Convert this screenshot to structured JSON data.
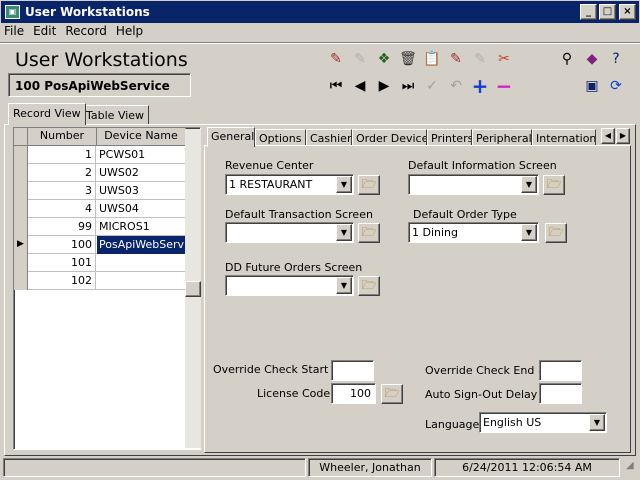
{
  "window": {
    "title": "User Workstations",
    "btn_min": "_",
    "btn_max": "□",
    "btn_close": "×"
  },
  "menu": {
    "file": "File",
    "edit": "Edit",
    "record": "Record",
    "help": "Help"
  },
  "header": {
    "title": "User Workstations",
    "record": "100 PosApiWebService"
  },
  "view_tabs": {
    "record": "Record View",
    "table": "Table View"
  },
  "grid": {
    "col_number": "Number",
    "col_name": "Device Name",
    "rows": [
      {
        "number": "1",
        "name": "PCWS01"
      },
      {
        "number": "2",
        "name": "UWS02"
      },
      {
        "number": "3",
        "name": "UWS03"
      },
      {
        "number": "4",
        "name": "UWS04"
      },
      {
        "number": "99",
        "name": "MICROS1"
      },
      {
        "number": "100",
        "name": "PosApiWebService"
      },
      {
        "number": "101",
        "name": ""
      },
      {
        "number": "102",
        "name": ""
      }
    ],
    "selected_index": 5
  },
  "tabs": [
    "General",
    "Options",
    "Cashier",
    "Order Devices",
    "Printers",
    "Peripherals",
    "Internation"
  ],
  "form": {
    "revenue_center_label": "Revenue Center",
    "revenue_center_value": "1  RESTAURANT",
    "default_info_screen_label": "Default Information Screen",
    "default_info_screen_value": "",
    "default_txn_screen_label": "Default Transaction Screen",
    "default_txn_screen_value": "",
    "default_order_type_label": "Default Order Type",
    "default_order_type_value": "1  Dining",
    "dd_future_label": "DD Future Orders Screen",
    "dd_future_value": "",
    "override_start_label": "Override Check Start #",
    "override_start_value": "",
    "override_end_label": "Override Check End #",
    "override_end_value": "",
    "license_code_label": "License Code",
    "license_code_value": "100",
    "auto_signout_label": "Auto Sign-Out Delay",
    "auto_signout_value": "",
    "language_label": "Language",
    "language_value": "English US"
  },
  "status": {
    "user": "Wheeler, Jonathan",
    "datetime": "6/24/2011 12:06:54 AM"
  }
}
